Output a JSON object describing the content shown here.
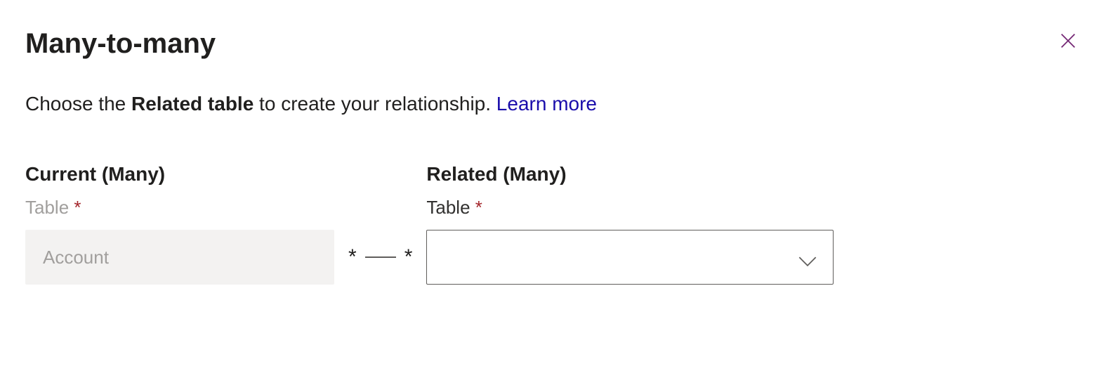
{
  "header": {
    "title": "Many-to-many"
  },
  "description": {
    "prefix": "Choose the ",
    "bold_part": "Related table",
    "suffix": " to create your relationship. ",
    "learn_more_label": "Learn more"
  },
  "current_section": {
    "heading": "Current (Many)",
    "field_label": "Table",
    "required_marker": "*",
    "value": "Account"
  },
  "connector": {
    "left_star": "*",
    "right_star": "*"
  },
  "related_section": {
    "heading": "Related (Many)",
    "field_label": "Table",
    "required_marker": "*",
    "selected_value": ""
  }
}
